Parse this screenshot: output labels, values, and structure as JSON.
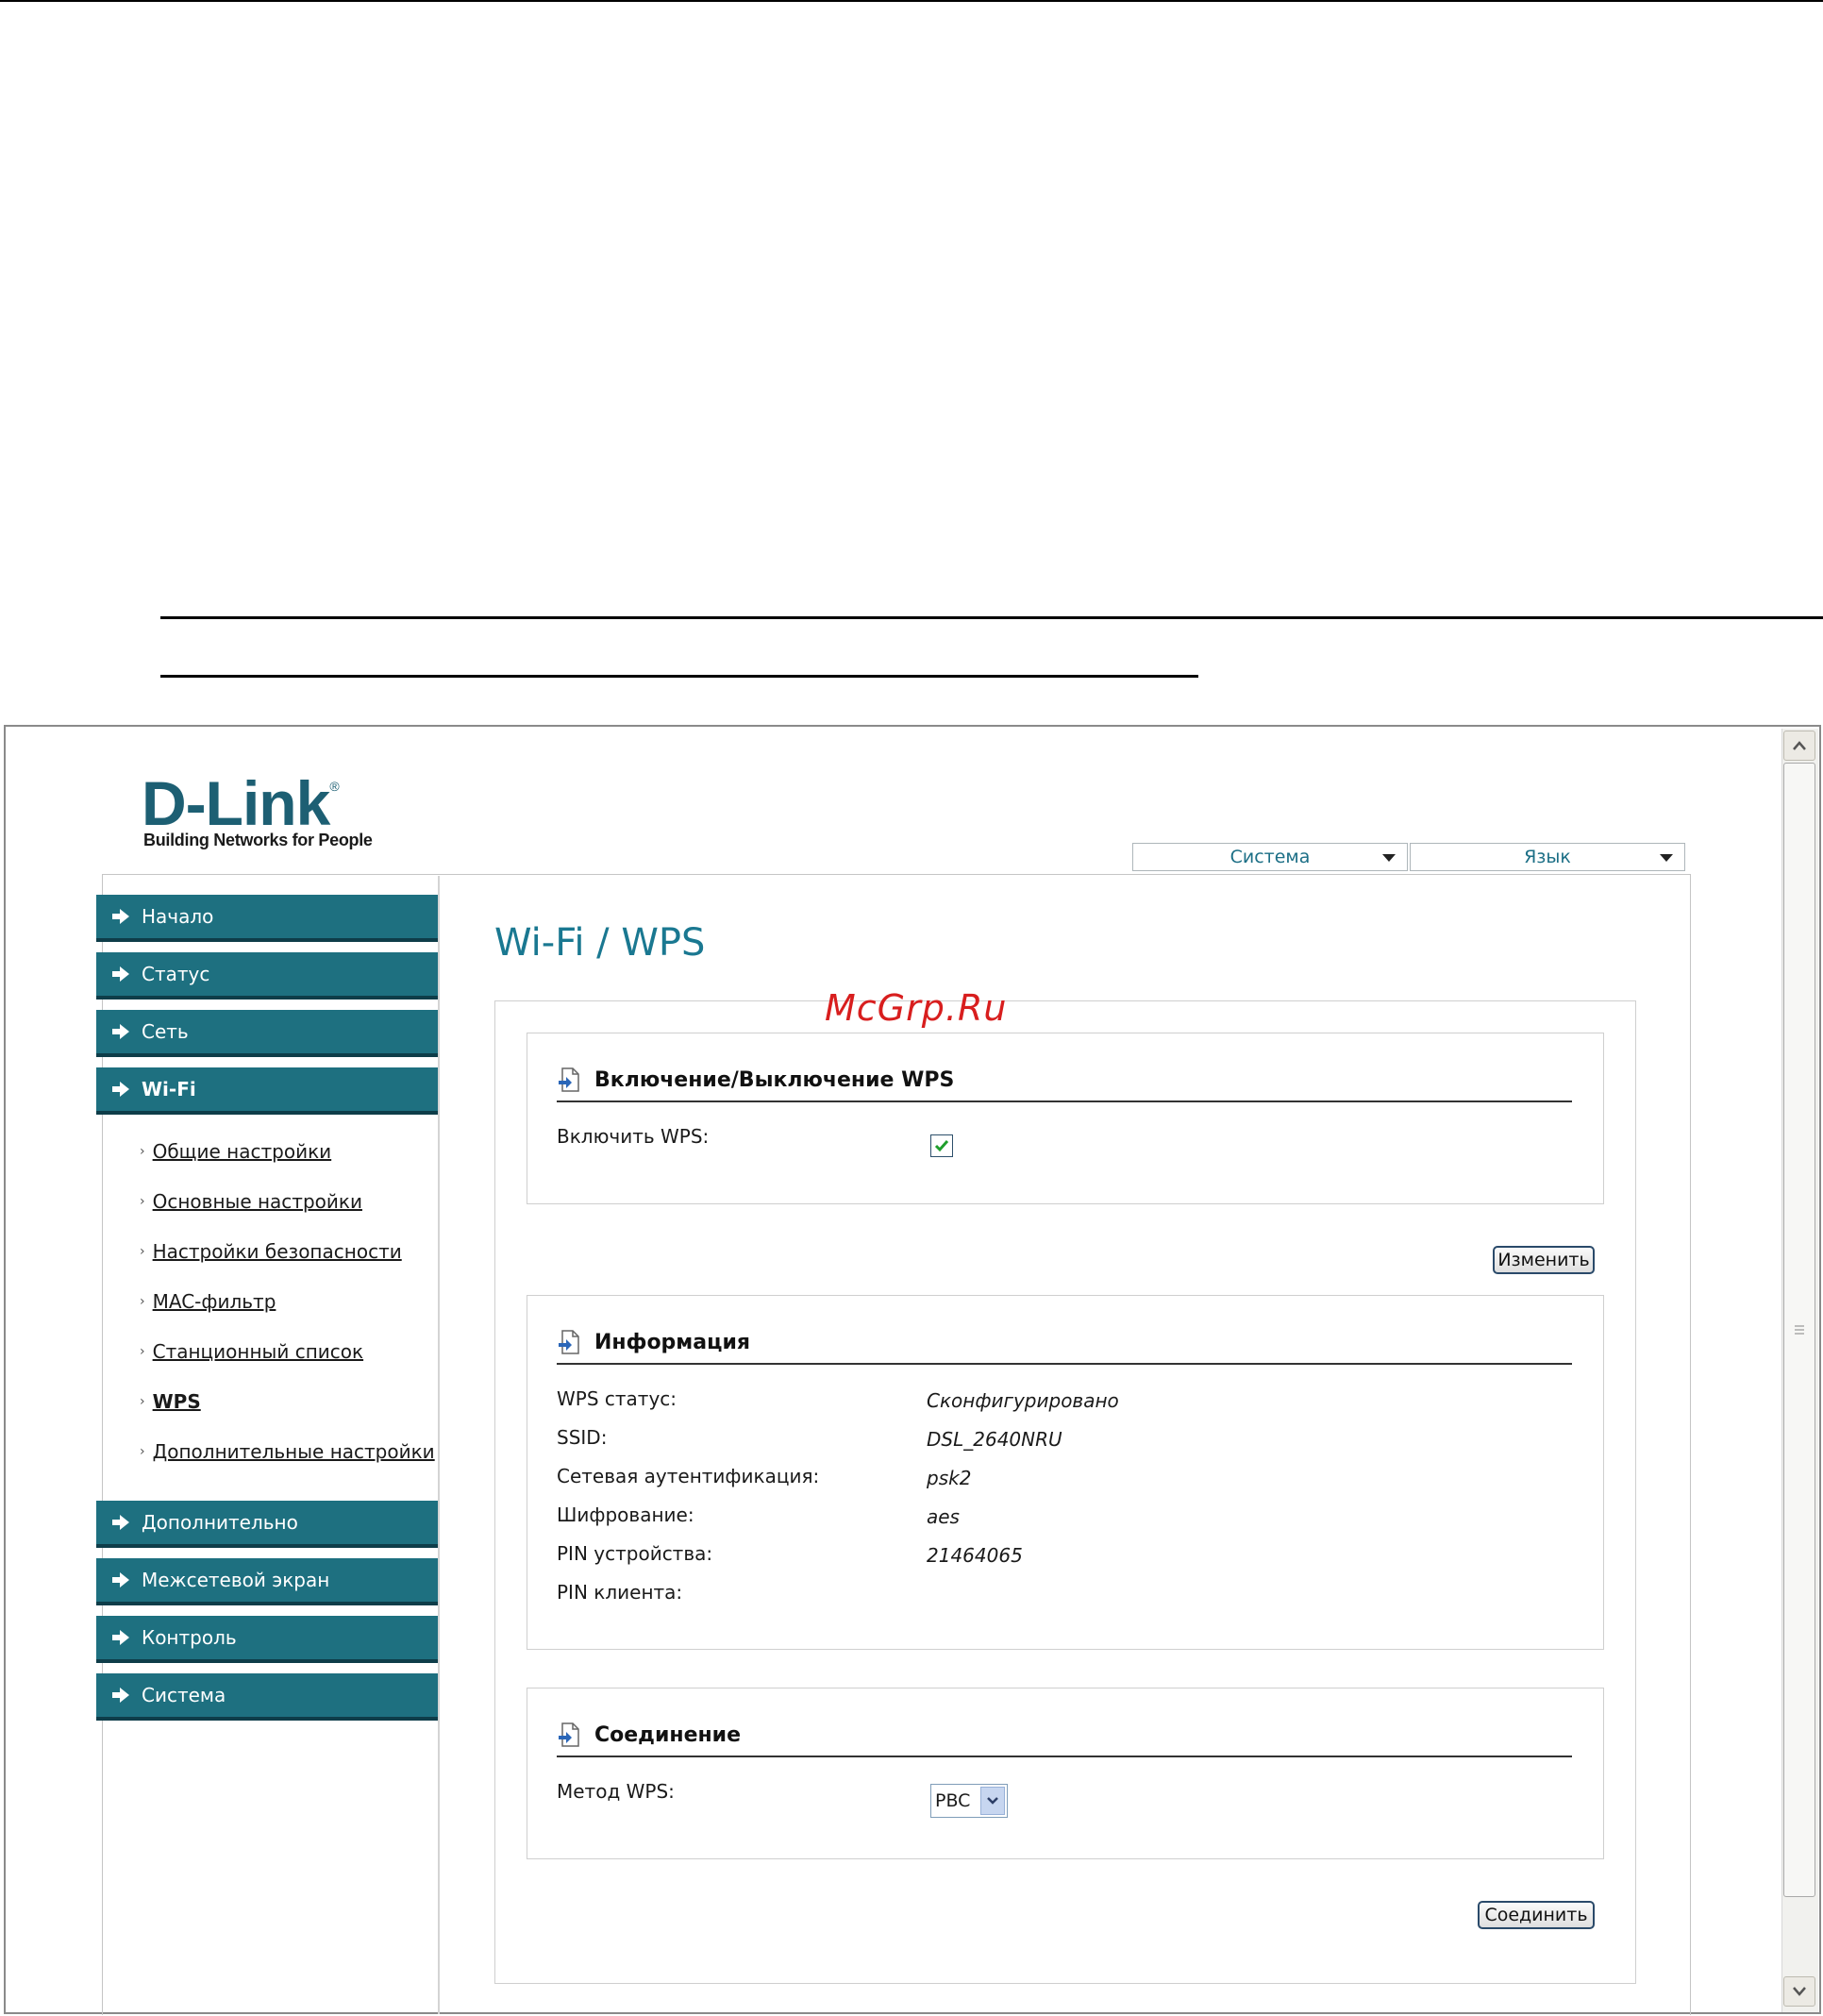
{
  "header": {
    "logo_title": "D-Link",
    "logo_registered": "®",
    "logo_tagline": "Building Networks for People",
    "menu_system": "Система",
    "menu_language": "Язык"
  },
  "sidebar": {
    "items_top": [
      {
        "label": "Начало"
      },
      {
        "label": "Статус"
      },
      {
        "label": "Сеть"
      },
      {
        "label": "Wi-Fi"
      }
    ],
    "subitems": [
      {
        "label": "Общие настройки"
      },
      {
        "label": "Основные настройки"
      },
      {
        "label": "Настройки безопасности"
      },
      {
        "label": "MAC-фильтр"
      },
      {
        "label": "Станционный список"
      },
      {
        "label": "WPS"
      },
      {
        "label": "Дополнительные настройки"
      }
    ],
    "items_bottom": [
      {
        "label": "Дополнительно"
      },
      {
        "label": "Межсетевой экран"
      },
      {
        "label": "Контроль"
      },
      {
        "label": "Система"
      }
    ]
  },
  "page": {
    "title": "Wi-Fi /  WPS",
    "watermark": "McGrp.Ru"
  },
  "wps_toggle": {
    "title": "Включение/Выключение WPS",
    "enable_label": "Включить WPS:",
    "enabled": true,
    "change_button": "Изменить"
  },
  "info": {
    "title": "Информация",
    "rows": [
      {
        "label": "WPS статус:",
        "value": "Сконфигурировано"
      },
      {
        "label": "SSID:",
        "value": "DSL_2640NRU"
      },
      {
        "label": "Сетевая аутентификация:",
        "value": "psk2"
      },
      {
        "label": "Шифрование:",
        "value": "aes"
      },
      {
        "label": "PIN устройства:",
        "value": "21464065"
      },
      {
        "label": "PIN клиента:",
        "value": ""
      }
    ]
  },
  "connection": {
    "title": "Соединение",
    "method_label": "Метод WPS:",
    "method_value": "PBC",
    "connect_button": "Соединить"
  },
  "colors": {
    "nav_bg": "#1e7080",
    "title_color": "#1a7891",
    "watermark": "#d81e1e"
  }
}
